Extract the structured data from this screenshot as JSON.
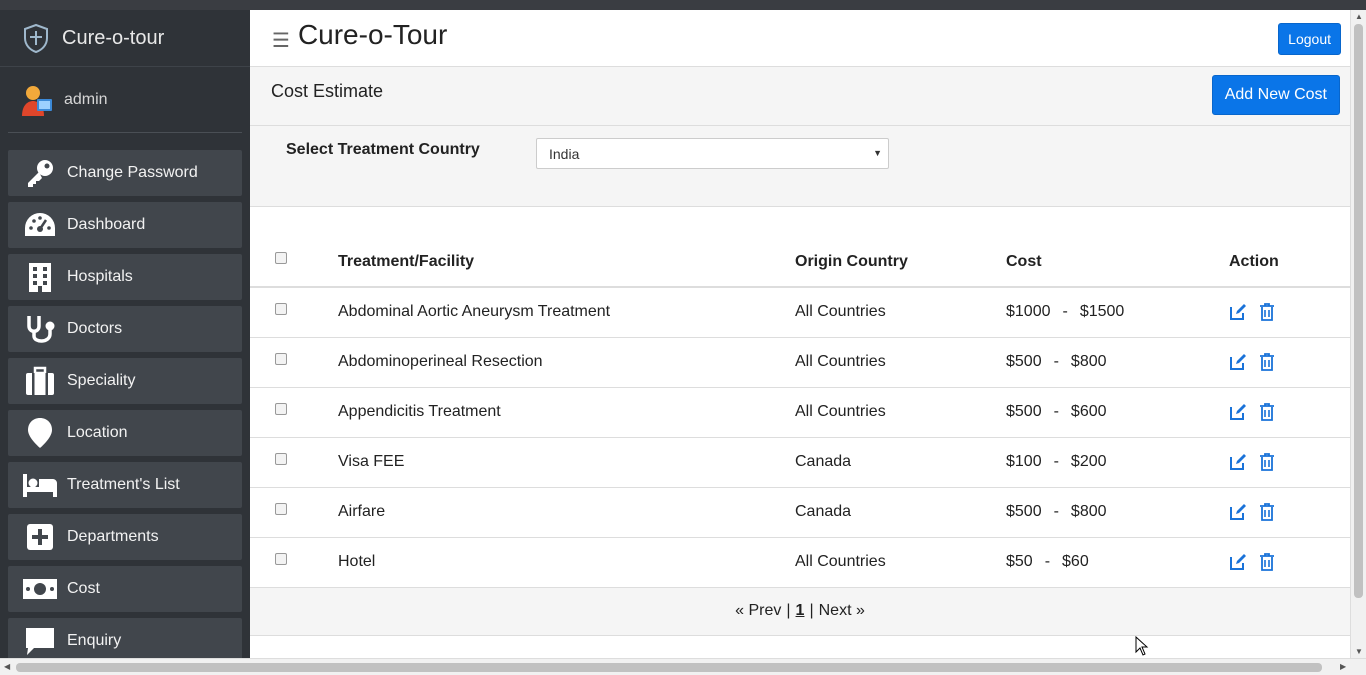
{
  "app": {
    "brand": "Cure-o-tour",
    "title": "Cure-o-Tour"
  },
  "user": {
    "name": "admin"
  },
  "header": {
    "logout_label": "Logout"
  },
  "sidebar": {
    "items": [
      {
        "label": "Change Password",
        "icon": "key-icon"
      },
      {
        "label": "Dashboard",
        "icon": "gauge-icon"
      },
      {
        "label": "Hospitals",
        "icon": "building-icon"
      },
      {
        "label": "Doctors",
        "icon": "stethoscope-icon"
      },
      {
        "label": "Speciality",
        "icon": "suitcase-icon"
      },
      {
        "label": "Location",
        "icon": "map-pin-icon"
      },
      {
        "label": "Treatment's List",
        "icon": "bed-icon"
      },
      {
        "label": "Departments",
        "icon": "plus-square-icon"
      },
      {
        "label": "Cost",
        "icon": "money-icon"
      },
      {
        "label": "Enquiry",
        "icon": "comment-icon"
      }
    ]
  },
  "panel": {
    "title": "Cost Estimate",
    "add_label": "Add New Cost",
    "filter_label": "Select Treatment Country",
    "selected_country": "India"
  },
  "table": {
    "headers": {
      "name": "Treatment/Facility",
      "origin": "Origin Country",
      "cost": "Cost",
      "action": "Action"
    },
    "rows": [
      {
        "name": "Abdominal Aortic Aneurysm Treatment",
        "origin": "All Countries",
        "min": "$1000",
        "max": "$1500"
      },
      {
        "name": "Abdominoperineal Resection",
        "origin": "All Countries",
        "min": "$500",
        "max": "$800"
      },
      {
        "name": "Appendicitis Treatment",
        "origin": "All Countries",
        "min": "$500",
        "max": "$600"
      },
      {
        "name": "Visa FEE",
        "origin": "Canada",
        "min": "$100",
        "max": "$200"
      },
      {
        "name": "Airfare",
        "origin": "Canada",
        "min": "$500",
        "max": "$800"
      },
      {
        "name": "Hotel",
        "origin": "All Countries",
        "min": "$50",
        "max": "$60"
      }
    ],
    "range_sep": "-"
  },
  "pager": {
    "prev": "« Prev",
    "sep": "|",
    "current": "1",
    "next": "Next »"
  },
  "colors": {
    "accent": "#0a75e8",
    "sidebar_bg": "#2f3338",
    "menu_item_bg": "#41464c"
  }
}
